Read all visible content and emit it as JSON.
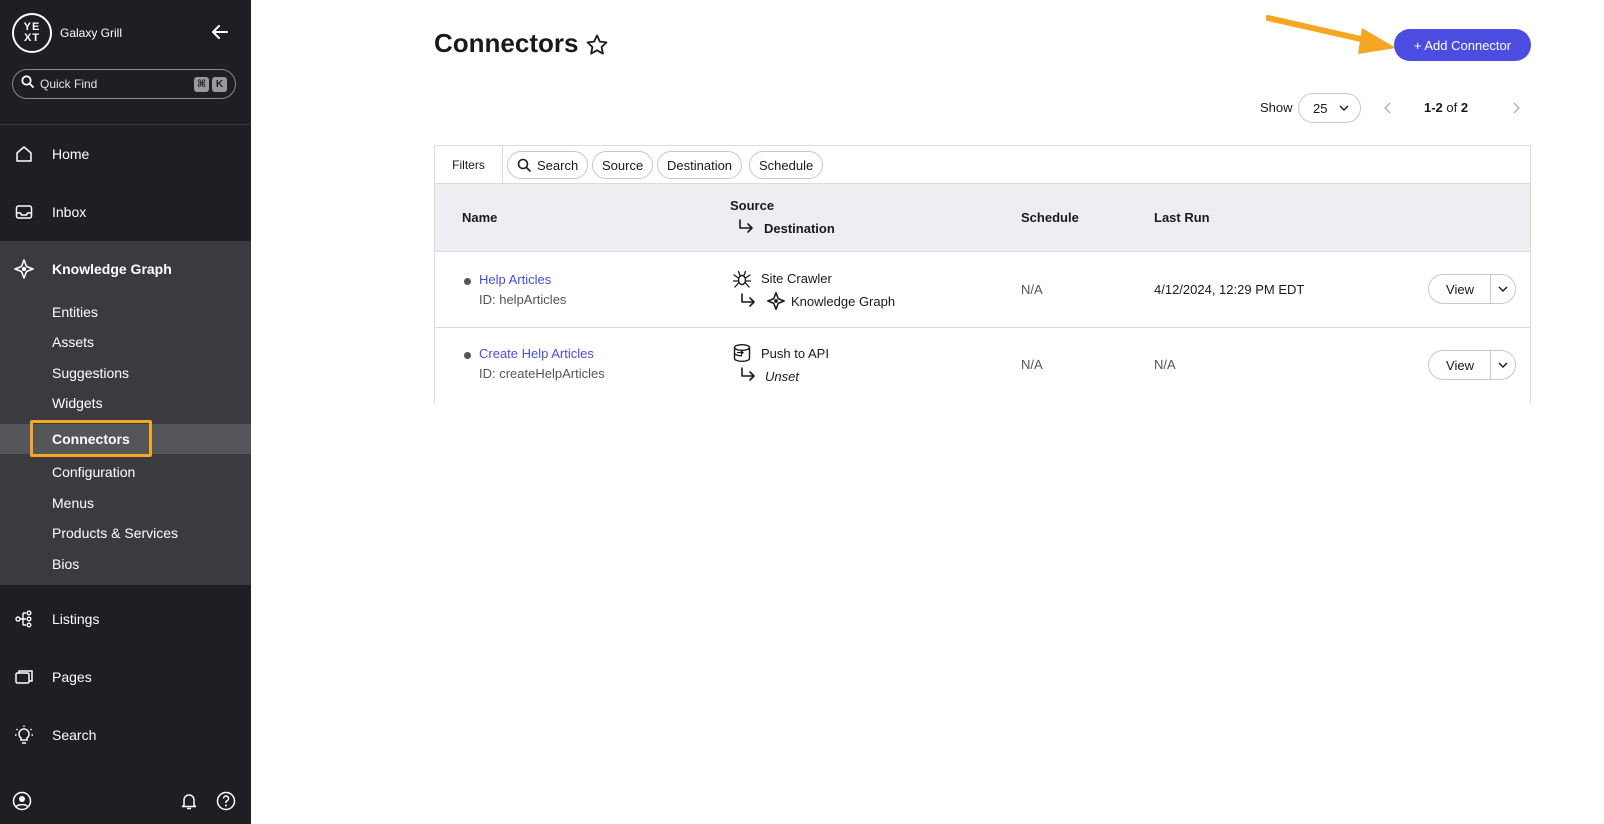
{
  "brand": {
    "name": "Galaxy Grill",
    "logo_text": "YE XT"
  },
  "quickfind": {
    "placeholder": "Quick Find",
    "key1": "⌘",
    "key2": "K"
  },
  "nav": {
    "home": "Home",
    "inbox": "Inbox",
    "knowledge_graph": "Knowledge Graph",
    "kg_items": [
      "Entities",
      "Assets",
      "Suggestions",
      "Widgets",
      "Connectors",
      "Configuration",
      "Menus",
      "Products & Services",
      "Bios"
    ],
    "listings": "Listings",
    "pages": "Pages",
    "search": "Search"
  },
  "main": {
    "title": "Connectors",
    "add_button": "+ Add Connector",
    "show_label": "Show",
    "page_size": "25",
    "range_bold": "1-2",
    "range_of": "of",
    "range_total": "2"
  },
  "filters": {
    "label": "Filters",
    "chips": [
      "Search",
      "Source",
      "Destination",
      "Schedule"
    ]
  },
  "table": {
    "headers": {
      "name": "Name",
      "source": "Source",
      "destination": "Destination",
      "schedule": "Schedule",
      "last_run": "Last Run"
    },
    "rows": [
      {
        "name": "Help Articles",
        "id": "ID: helpArticles",
        "source": "Site Crawler",
        "destination": "Knowledge Graph",
        "schedule": "N/A",
        "last_run": "4/12/2024, 12:29 PM EDT",
        "action": "View"
      },
      {
        "name": "Create Help Articles",
        "id": "ID: createHelpArticles",
        "source": "Push to API",
        "destination": "Unset",
        "schedule": "N/A",
        "last_run": "N/A",
        "action": "View"
      }
    ]
  },
  "colors": {
    "sidebar": "#1e1f22",
    "sidebar_section": "#3a3b3e",
    "accent": "#4a4ddf",
    "highlight": "#f5a623"
  }
}
